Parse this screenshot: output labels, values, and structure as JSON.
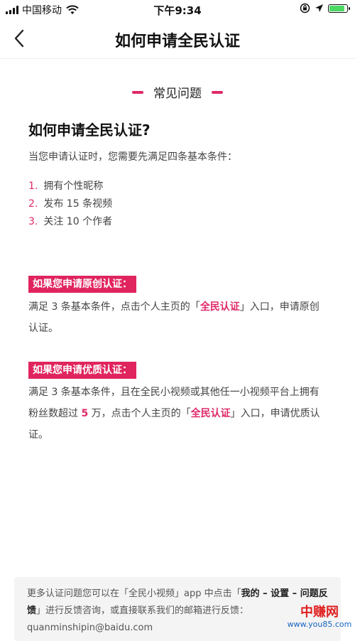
{
  "status_bar": {
    "carrier": "中国移动",
    "time": "下午9:34"
  },
  "nav": {
    "title": "如何申请全民认证"
  },
  "section": {
    "title": "常见问题"
  },
  "faq": {
    "question": "如何申请全民认证?",
    "intro": "当您申请认证时，您需要先满足四条基本条件：",
    "conditions": [
      {
        "num": "1.",
        "text": "拥有个性昵称"
      },
      {
        "num": "2.",
        "text": "发布 15 条视频"
      },
      {
        "num": "3.",
        "text": "关注 10 个作者"
      }
    ]
  },
  "original": {
    "tag": "如果您申请原创认证：",
    "text_a": "满足 3 条基本条件，点击个人主页的「",
    "highlight": "全民认证",
    "text_b": "」入口，申请原创认证。"
  },
  "quality": {
    "tag": "如果您申请优质认证：",
    "text_a": "满足 3 条基本条件，且在全民小视频或其他任一小视频平台上拥有粉丝数超过 ",
    "num": "5",
    "text_b": " 万，点击个人主页的「",
    "highlight": "全民认证",
    "text_c": "」入口，申请优质认证。"
  },
  "footer": {
    "text_a": "更多认证问题您可以在「全民小视频」app 中点击「",
    "bold_a": "我的 – 设置 – 问题反馈",
    "text_b": "」进行反馈咨询，或直接联系我们的邮箱进行反馈：",
    "email": "quanminshipin@baidu.com"
  },
  "watermark": {
    "cn": "中赚网",
    "url": "www.you85.com"
  },
  "colors": {
    "accent": "#e02a6a",
    "tag_bg": "#e0245e",
    "battery": "#4cd964"
  },
  "battery_level": 0.9
}
